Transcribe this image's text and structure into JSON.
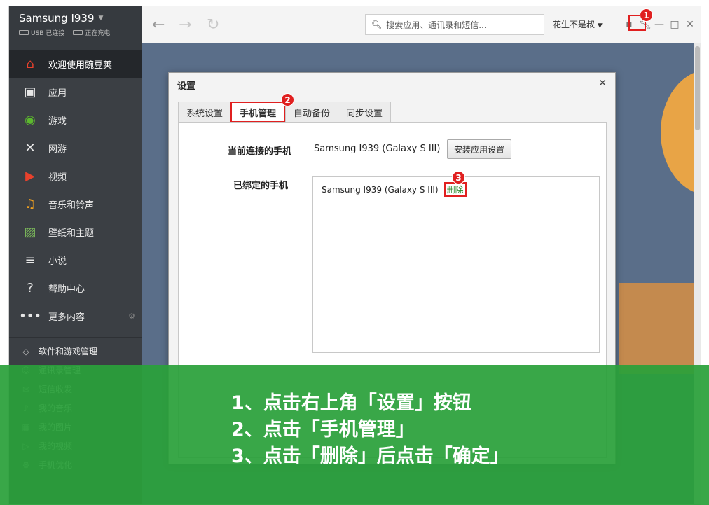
{
  "device": {
    "name": "Samsung I939",
    "usb_status": "USB 已连接",
    "charge_status": "正在充电"
  },
  "sidebar": {
    "items": [
      {
        "label": "欢迎使用豌豆荚",
        "icon": "home-icon",
        "color": "#e8412c"
      },
      {
        "label": "应用",
        "icon": "briefcase-icon",
        "color": "#e6e6e6"
      },
      {
        "label": "游戏",
        "icon": "gamepad-icon",
        "color": "#5cb82e"
      },
      {
        "label": "网游",
        "icon": "swords-icon",
        "color": "#e6e6e6"
      },
      {
        "label": "视频",
        "icon": "play-icon",
        "color": "#e8412c"
      },
      {
        "label": "音乐和铃声",
        "icon": "music-note-icon",
        "color": "#f0a020"
      },
      {
        "label": "壁纸和主题",
        "icon": "picture-icon",
        "color": "#7ab65a"
      },
      {
        "label": "小说",
        "icon": "book-icon",
        "color": "#e6e6e6"
      },
      {
        "label": "帮助中心",
        "icon": "help-icon",
        "color": "#e6e6e6"
      },
      {
        "label": "更多内容",
        "icon": "more-dots-icon",
        "color": "#e6e6e6"
      }
    ],
    "manage_items": [
      {
        "label": "软件和游戏管理",
        "icon": "cube-icon"
      },
      {
        "label": "通讯录管理",
        "icon": "contacts-icon"
      },
      {
        "label": "短信收发",
        "icon": "sms-icon"
      },
      {
        "label": "我的音乐",
        "icon": "music-icon"
      },
      {
        "label": "我的图片",
        "icon": "image-icon"
      },
      {
        "label": "我的视频",
        "icon": "video-icon"
      },
      {
        "label": "手机优化",
        "icon": "optimize-icon"
      }
    ]
  },
  "topbar": {
    "search_placeholder": "搜索应用、通讯录和短信...",
    "username": "花生不是叔"
  },
  "dialog": {
    "title": "设置",
    "tabs": [
      "系统设置",
      "手机管理",
      "自动备份",
      "同步设置"
    ],
    "active_tab": 1,
    "connected_label": "当前连接的手机",
    "connected_phone": "Samsung I939 (Galaxy S III)",
    "install_button": "安装应用设置",
    "bound_label": "已绑定的手机",
    "bound_phone": "Samsung I939 (Galaxy S III)",
    "delete_link": "删除"
  },
  "markers": [
    "1",
    "2",
    "3"
  ],
  "overlay": {
    "line1": "1、点击右上角「设置」按钮",
    "line2": "2、点击「手机管理」",
    "line3": "3、点击「删除」后点击「确定」"
  }
}
